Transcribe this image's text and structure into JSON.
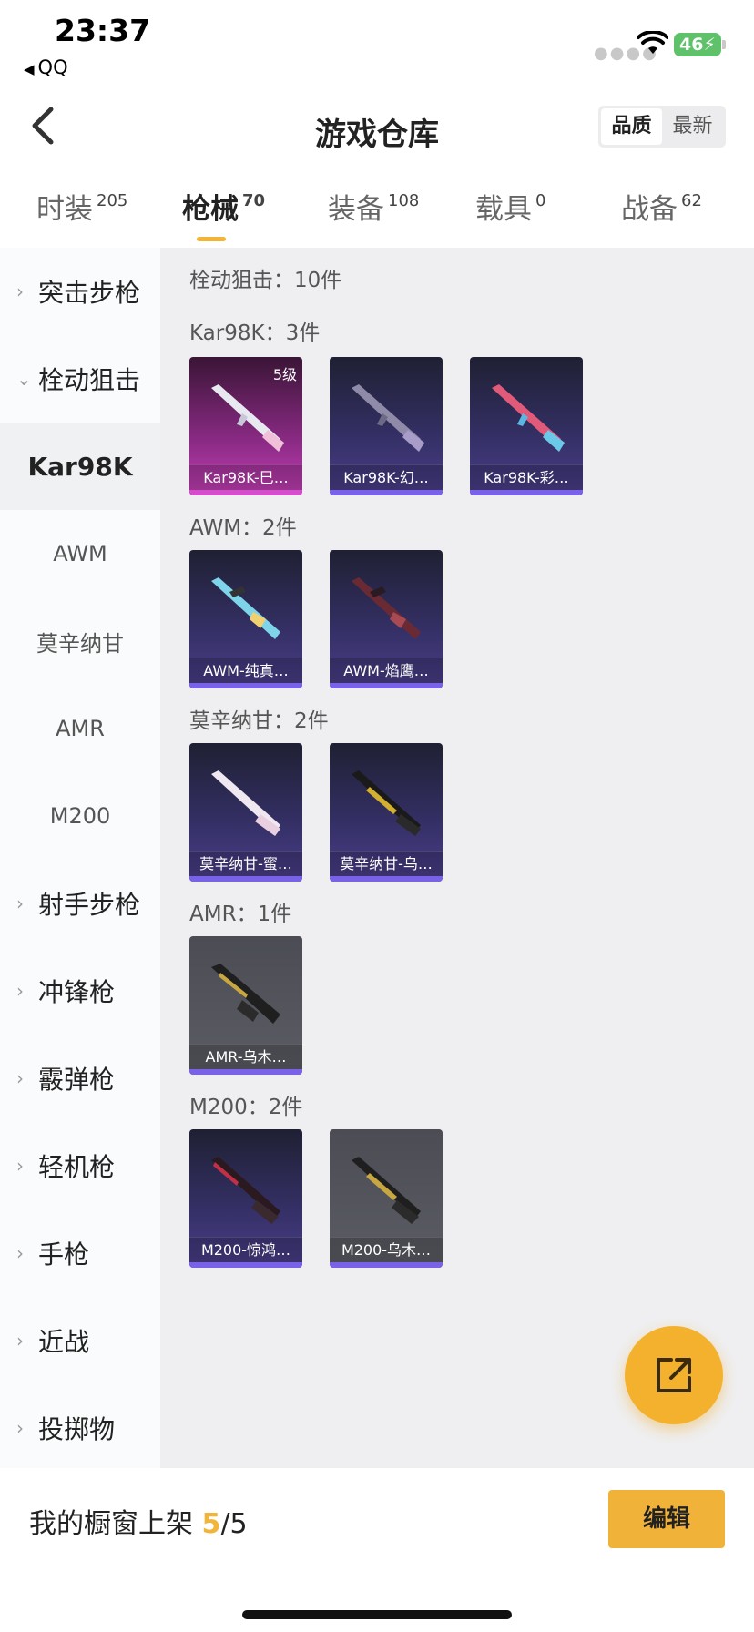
{
  "status_bar": {
    "time": "23:37",
    "back_app": "QQ",
    "battery": "46"
  },
  "header": {
    "title": "游戏仓库",
    "sort_options": [
      "品质",
      "最新"
    ],
    "sort_selected": "品质"
  },
  "tabs": [
    {
      "label": "时装",
      "count": "205"
    },
    {
      "label": "枪械",
      "count": "70",
      "active": true
    },
    {
      "label": "装备",
      "count": "108"
    },
    {
      "label": "载具",
      "count": "0"
    },
    {
      "label": "战备",
      "count": "62"
    }
  ],
  "sidebar": {
    "items": [
      {
        "label": "突击步枪",
        "chevron": "›"
      },
      {
        "label": "栓动狙击",
        "chevron": "⌄"
      },
      {
        "label": "Kar98K"
      },
      {
        "label": "AWM"
      },
      {
        "label": "莫辛纳甘"
      },
      {
        "label": "AMR"
      },
      {
        "label": "M200"
      },
      {
        "label": "射手步枪",
        "chevron": "›"
      },
      {
        "label": "冲锋枪",
        "chevron": "›"
      },
      {
        "label": "霰弹枪",
        "chevron": "›"
      },
      {
        "label": "轻机枪",
        "chevron": "›"
      },
      {
        "label": "手枪",
        "chevron": "›"
      },
      {
        "label": "近战",
        "chevron": "›"
      },
      {
        "label": "投掷物",
        "chevron": "›"
      }
    ]
  },
  "content": {
    "total_label": "栓动狙击：10件",
    "groups": [
      {
        "label": "Kar98K：3件",
        "items": [
          {
            "name": "Kar98K-巳…",
            "level": "5级",
            "rarity": "pink"
          },
          {
            "name": "Kar98K-幻…",
            "rarity": "purple"
          },
          {
            "name": "Kar98K-彩…",
            "rarity": "purple"
          }
        ]
      },
      {
        "label": "AWM：2件",
        "items": [
          {
            "name": "AWM-纯真…",
            "rarity": "purple"
          },
          {
            "name": "AWM-焰鹰…",
            "rarity": "purple"
          }
        ]
      },
      {
        "label": "莫辛纳甘：2件",
        "items": [
          {
            "name": "莫辛纳甘-蜜…",
            "rarity": "purple"
          },
          {
            "name": "莫辛纳甘-乌…",
            "rarity": "purple"
          }
        ]
      },
      {
        "label": "AMR：1件",
        "items": [
          {
            "name": "AMR-乌木…",
            "rarity": "grey"
          }
        ]
      },
      {
        "label": "M200：2件",
        "items": [
          {
            "name": "M200-惊鸿…",
            "rarity": "purple"
          },
          {
            "name": "M200-乌木…",
            "rarity": "grey"
          }
        ]
      }
    ]
  },
  "fab": {
    "icon": "share-external-icon"
  },
  "bottom": {
    "window_prefix": "我的橱窗上架 ",
    "window_count": "5",
    "window_total": "/5",
    "edit_label": "编辑"
  },
  "colors": {
    "accent": "#f2b53a",
    "purple_rarity": "#7a62e8",
    "pink_rarity": "#d44dca"
  }
}
